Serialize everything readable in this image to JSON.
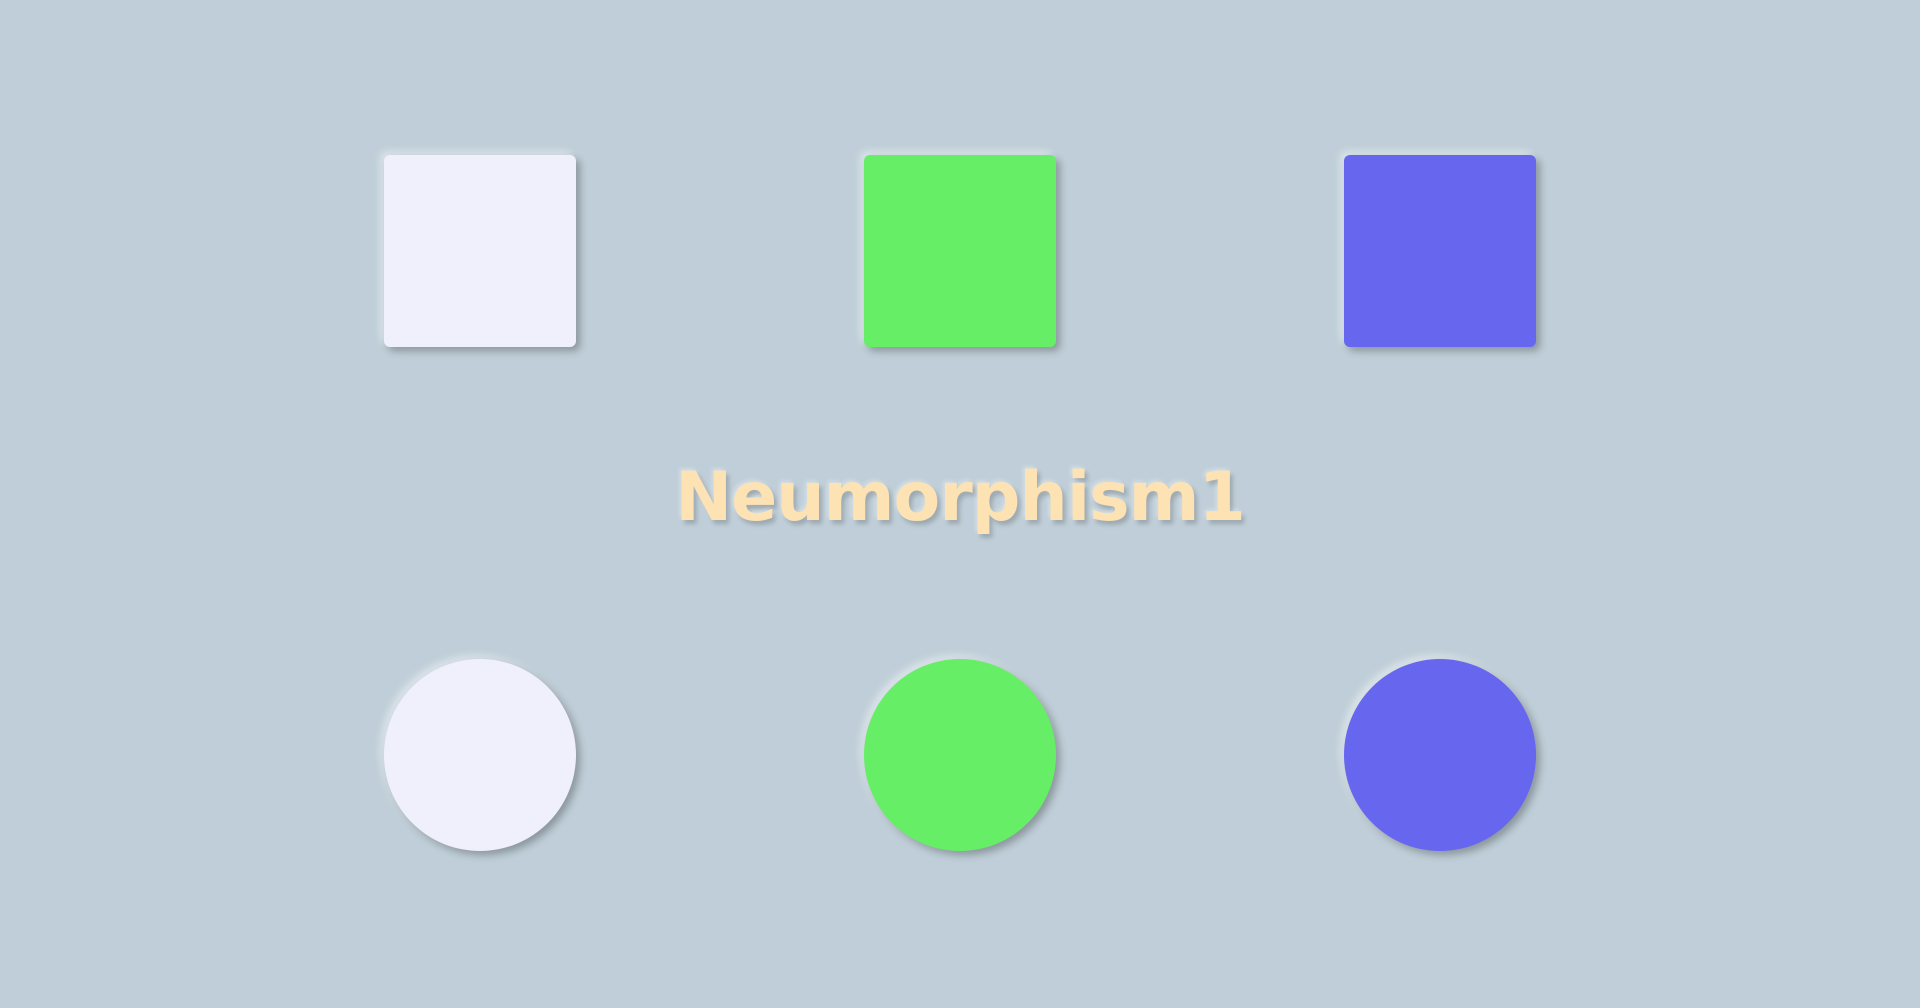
{
  "background_color": "#bfced8",
  "title": {
    "text": "Neumorphism1",
    "color": "#fde2b4"
  },
  "squares": [
    {
      "color": "#eff0fc"
    },
    {
      "color": "#66ef66"
    },
    {
      "color": "#6666ef"
    }
  ],
  "circles": [
    {
      "color": "#eff0fc"
    },
    {
      "color": "#66ef66"
    },
    {
      "color": "#6666ef"
    }
  ]
}
